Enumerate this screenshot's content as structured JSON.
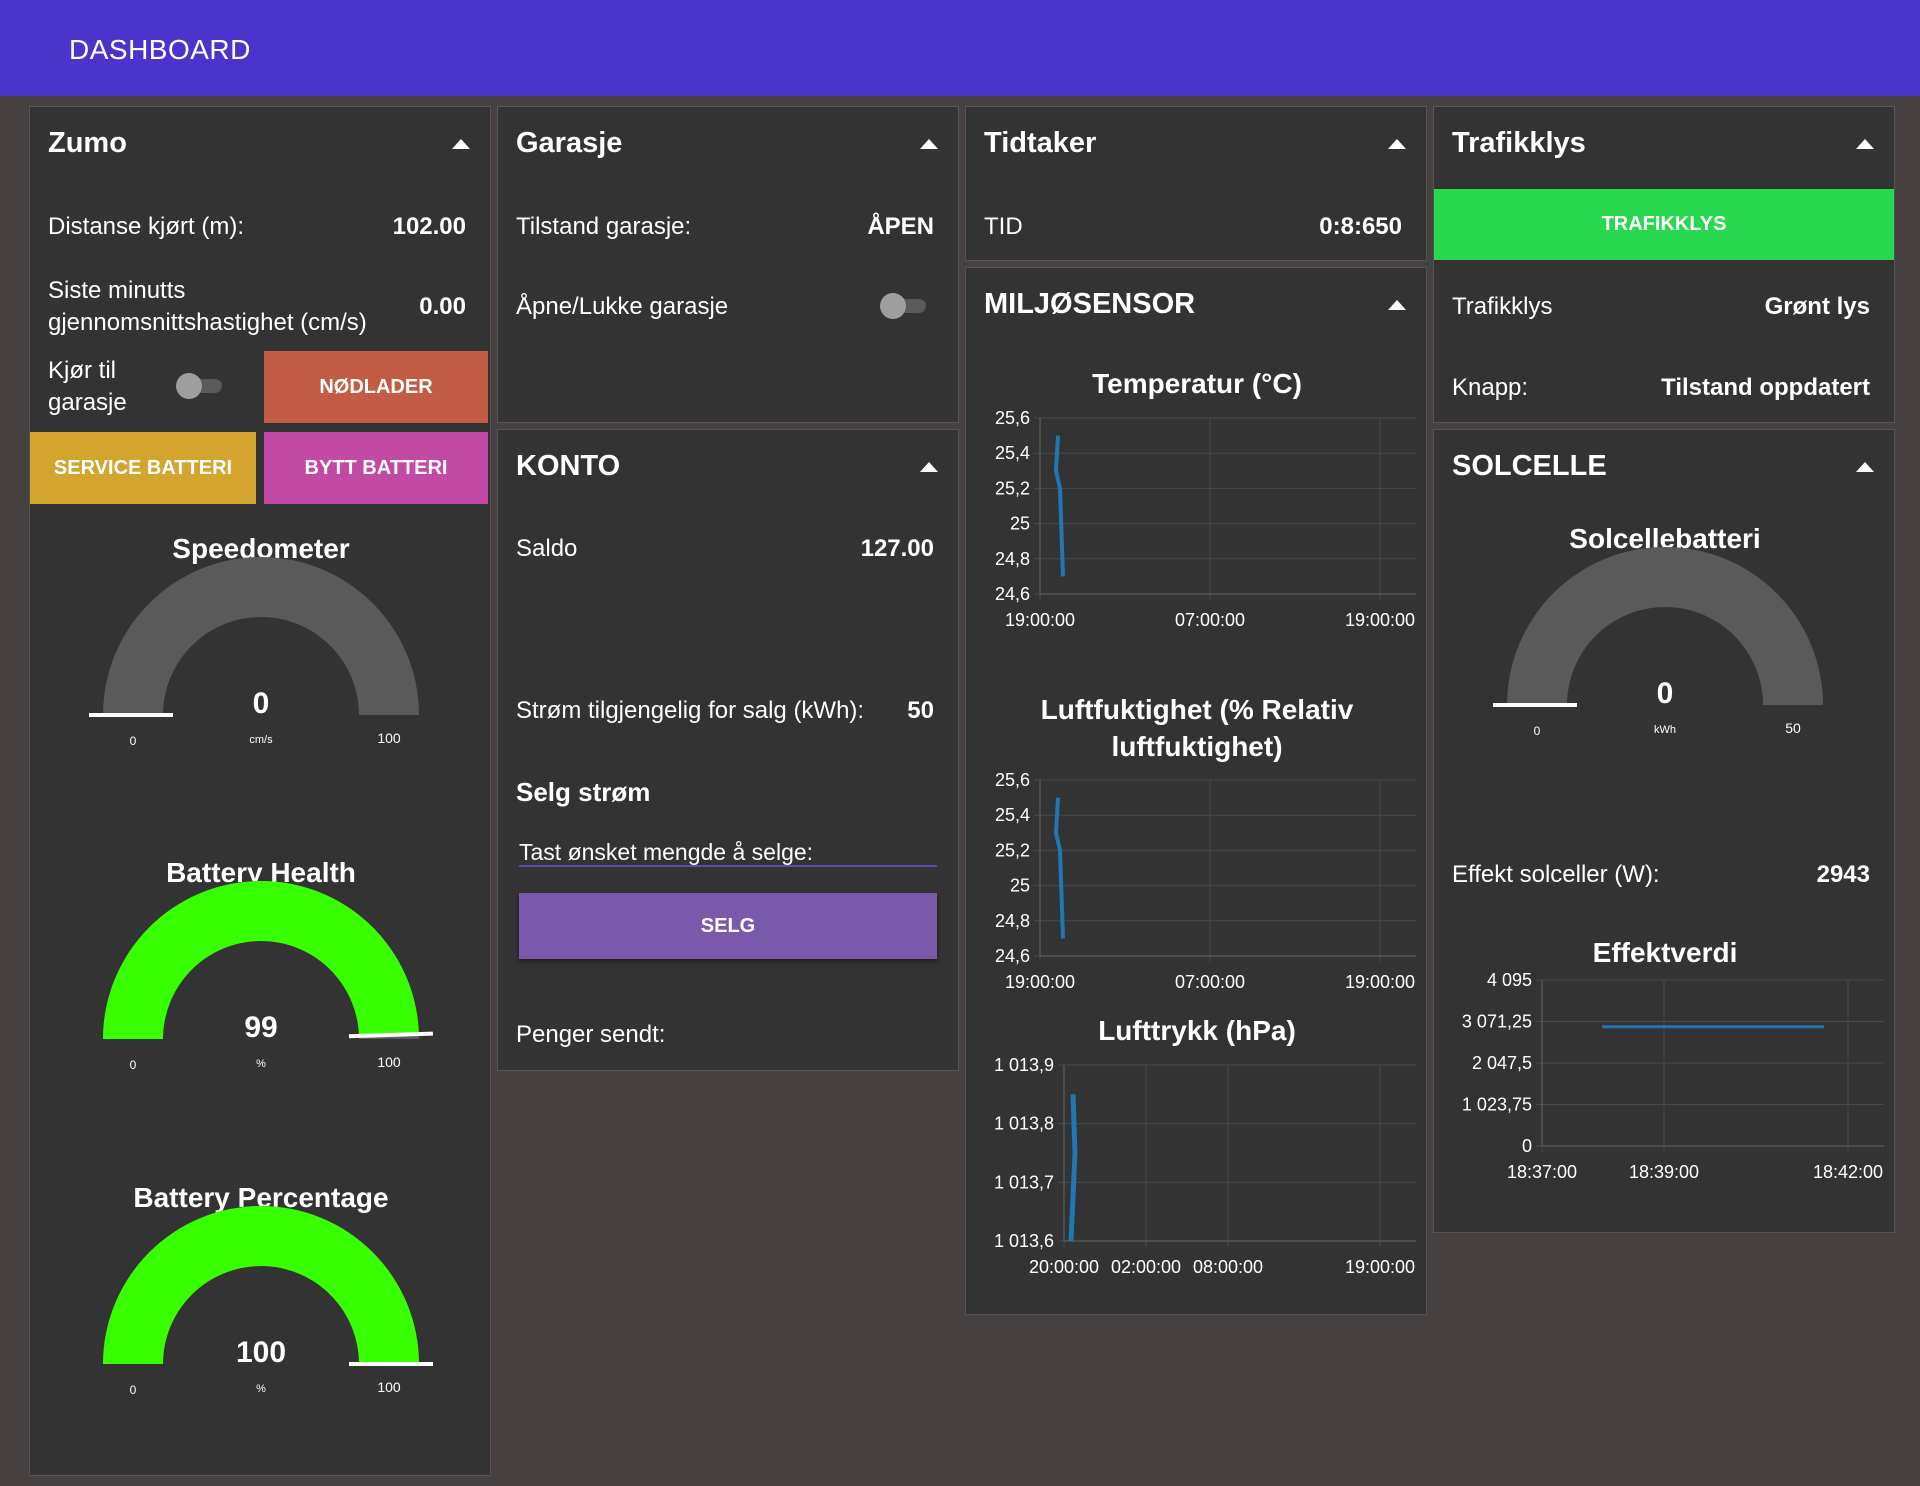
{
  "app": {
    "title": "DASHBOARD"
  },
  "zumo": {
    "title": "Zumo",
    "distance_label": "Distanse kjørt (m):",
    "distance_value": "102.00",
    "speed_label": "Siste minutts gjennomsnittshastighet (cm/s)",
    "speed_value": "0.00",
    "drive_label": "Kjør til garasje",
    "drive_toggle": false,
    "btn_emergency": "NØDLADER",
    "btn_service": "SERVICE BATTERI",
    "btn_swap": "BYTT BATTERI",
    "colors": {
      "emergency": "#c35c45",
      "service": "#d3a52e",
      "swap": "#c249a4"
    },
    "gauges": [
      {
        "title": "Speedometer",
        "value": "0",
        "unit": "cm/s",
        "min": "0",
        "max": "100",
        "fraction": 0.0,
        "color": "#5a5a5a"
      },
      {
        "title": "Battery Health",
        "value": "99",
        "unit": "%",
        "min": "0",
        "max": "100",
        "fraction": 0.99,
        "color": "#38ff00"
      },
      {
        "title": "Battery Percentage",
        "value": "100",
        "unit": "%",
        "min": "0",
        "max": "100",
        "fraction": 1.0,
        "color": "#38ff00"
      }
    ]
  },
  "garage": {
    "title": "Garasje",
    "state_label": "Tilstand garasje:",
    "state_value": "ÅPEN",
    "toggle_label": "Åpne/Lukke garasje",
    "toggle_on": false
  },
  "account": {
    "title": "KONTO",
    "balance_label": "Saldo",
    "balance_value": "127.00",
    "power_label": "Strøm tilgjengelig for salg (kWh):",
    "power_value": "50",
    "sell_heading": "Selg strøm",
    "sell_input_label": "Tast ønsket mengde å selge:",
    "sell_button": "SELG",
    "sent_label": "Penger sendt:",
    "colors": {
      "sell": "#7b59aa"
    }
  },
  "timer": {
    "title": "Tidtaker",
    "label": "TID",
    "value": "0:8:650"
  },
  "env": {
    "title": "MILJØSENSOR",
    "charts": [
      {
        "title": "Temperatur (°C)",
        "yticks": [
          "25,6",
          "25,4",
          "25,2",
          "25",
          "24,8",
          "24,6"
        ],
        "xticks": [
          "19:00:00",
          "07:00:00",
          "19:00:00"
        ]
      },
      {
        "title": "Luftfuktighet (% Relativ luftfuktighet)",
        "yticks": [
          "25,6",
          "25,4",
          "25,2",
          "25",
          "24,8",
          "24,6"
        ],
        "xticks": [
          "19:00:00",
          "07:00:00",
          "19:00:00"
        ]
      },
      {
        "title": "Lufttrykk (hPa)",
        "yticks": [
          "1 013,9",
          "1 013,8",
          "1 013,7",
          "1 013,6"
        ],
        "xticks": [
          "20:00:00",
          "02:00:00",
          "08:00:00",
          "19:00:00"
        ]
      }
    ]
  },
  "traffic": {
    "title": "Trafikklys",
    "button": "TRAFIKKLYS",
    "light_label": "Trafikklys",
    "light_value": "Grønt lys",
    "button_state_label": "Knapp:",
    "button_state_value": "Tilstand oppdatert",
    "colors": {
      "button": "#28d84f"
    }
  },
  "solar": {
    "title": "SOLCELLE",
    "gauge": {
      "title": "Solcellebatteri",
      "value": "0",
      "unit": "kWh",
      "min": "0",
      "max": "50",
      "fraction": 0.0,
      "color": "#5a5a5a"
    },
    "power_label": "Effekt solceller (W):",
    "power_value": "2943",
    "chart": {
      "title": "Effektverdi",
      "yticks": [
        "4 095",
        "3 071,25",
        "2 047,5",
        "1 023,75",
        "0"
      ],
      "xticks": [
        "18:37:00",
        "18:39:00",
        "18:42:00"
      ]
    }
  },
  "chart_data": [
    {
      "type": "line",
      "title": "Temperatur (°C)",
      "xlabel": "",
      "ylabel": "",
      "x_ticks": [
        "19:00:00",
        "07:00:00",
        "19:00:00"
      ],
      "ylim": [
        24.6,
        25.6
      ],
      "series": [
        {
          "x": [
            "19:00:00",
            "19:00:00",
            "19:00:00",
            "19:00:00"
          ],
          "values": [
            25.5,
            25.3,
            25.2,
            24.7
          ]
        }
      ]
    },
    {
      "type": "line",
      "title": "Luftfuktighet (% Relativ luftfuktighet)",
      "xlabel": "",
      "ylabel": "",
      "x_ticks": [
        "19:00:00",
        "07:00:00",
        "19:00:00"
      ],
      "ylim": [
        24.6,
        25.6
      ],
      "series": [
        {
          "x": [
            "19:00:00",
            "19:00:00",
            "19:00:00",
            "19:00:00"
          ],
          "values": [
            25.5,
            25.3,
            25.2,
            24.7
          ]
        }
      ]
    },
    {
      "type": "line",
      "title": "Lufttrykk (hPa)",
      "xlabel": "",
      "ylabel": "",
      "x_ticks": [
        "20:00:00",
        "02:00:00",
        "08:00:00",
        "19:00:00"
      ],
      "ylim": [
        1013.6,
        1013.9
      ],
      "series": [
        {
          "x": [
            "20:00:00",
            "20:00:00",
            "20:00:00"
          ],
          "values": [
            1013.85,
            1013.75,
            1013.6
          ]
        }
      ]
    },
    {
      "type": "line",
      "title": "Effektverdi",
      "xlabel": "",
      "ylabel": "",
      "x_ticks": [
        "18:37:00",
        "18:39:00",
        "18:42:00"
      ],
      "ylim": [
        0,
        4095
      ],
      "series": [
        {
          "x": [
            "18:38:00",
            "18:41:30"
          ],
          "values": [
            2943,
            2943
          ]
        }
      ]
    }
  ]
}
